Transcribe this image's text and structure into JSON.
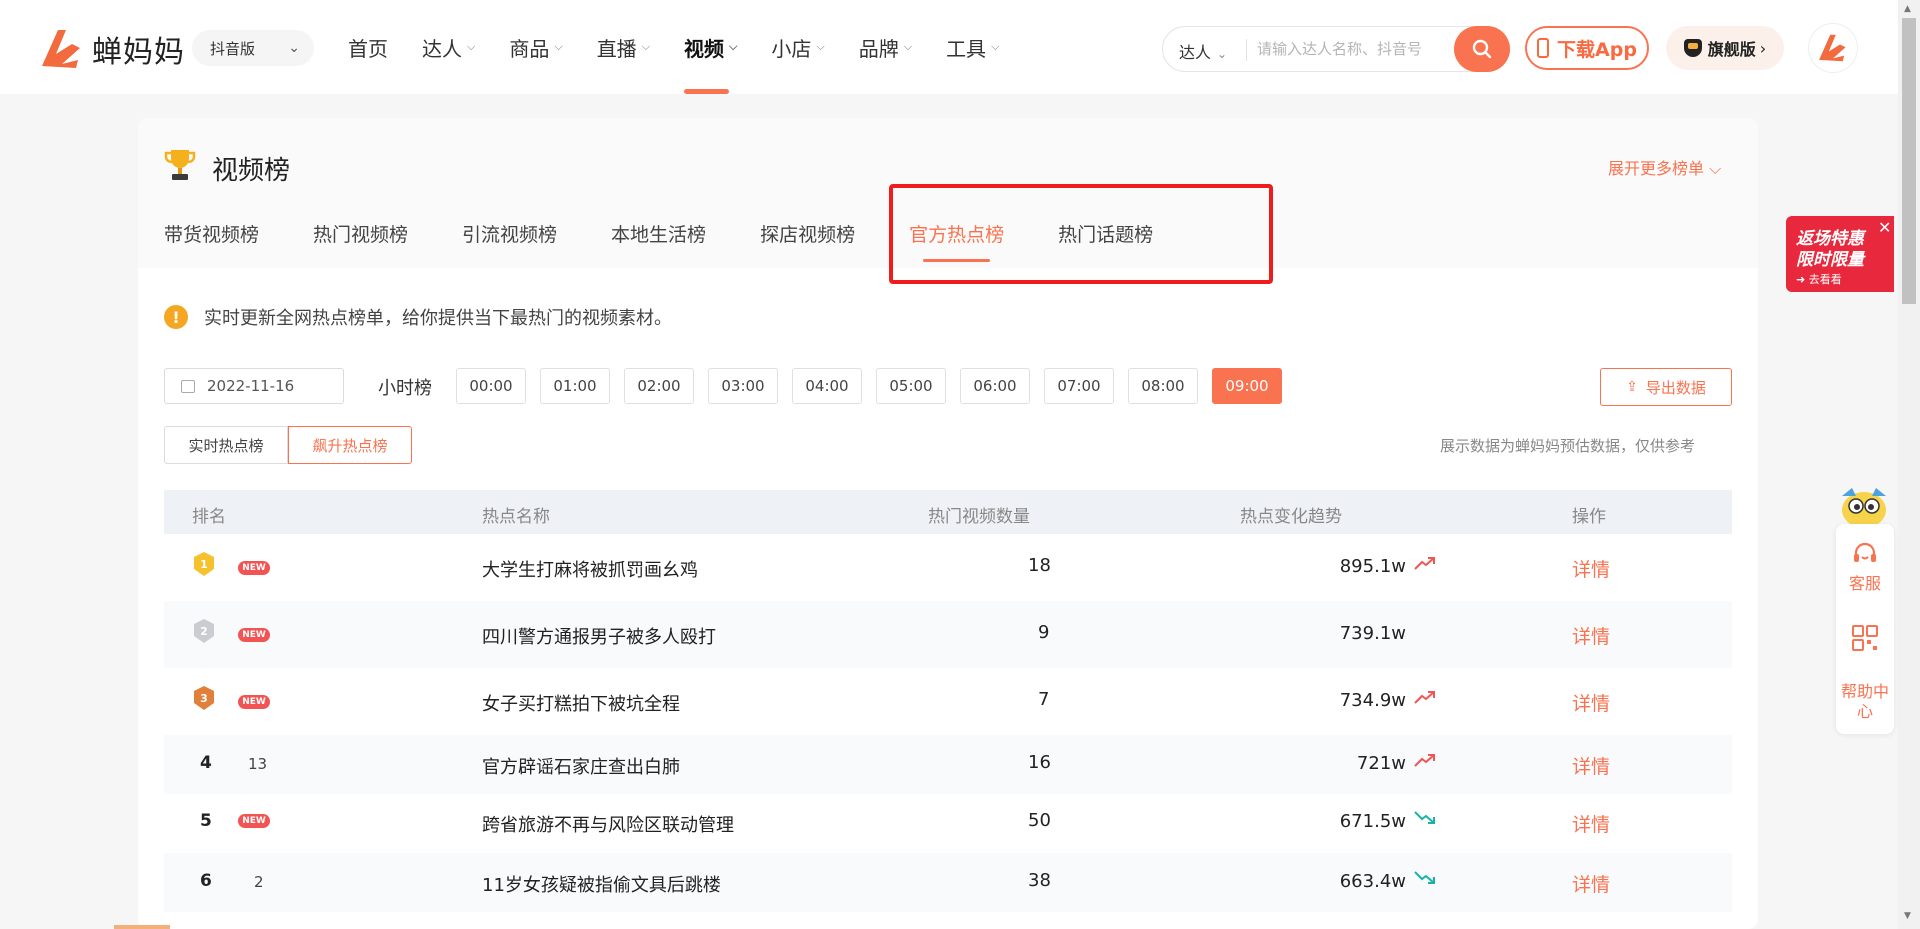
{
  "header": {
    "logo_text": "蝉妈妈",
    "platform": "抖音版",
    "nav": [
      {
        "label": "首页",
        "dropdown": false,
        "active": false
      },
      {
        "label": "达人",
        "dropdown": true,
        "active": false
      },
      {
        "label": "商品",
        "dropdown": true,
        "active": false
      },
      {
        "label": "直播",
        "dropdown": true,
        "active": false
      },
      {
        "label": "视频",
        "dropdown": true,
        "active": true
      },
      {
        "label": "小店",
        "dropdown": true,
        "active": false
      },
      {
        "label": "品牌",
        "dropdown": true,
        "active": false
      },
      {
        "label": "工具",
        "dropdown": true,
        "active": false
      }
    ],
    "search": {
      "type": "达人",
      "placeholder": "请输入达人名称、抖音号"
    },
    "download_label": "下载App",
    "flagship_label": "旗舰版"
  },
  "page": {
    "title": "视频榜",
    "expand_more": "展开更多榜单",
    "tabs": [
      {
        "label": "带货视频榜",
        "active": false
      },
      {
        "label": "热门视频榜",
        "active": false
      },
      {
        "label": "引流视频榜",
        "active": false
      },
      {
        "label": "本地生活榜",
        "active": false
      },
      {
        "label": "探店视频榜",
        "active": false
      },
      {
        "label": "官方热点榜",
        "active": true
      },
      {
        "label": "热门话题榜",
        "active": false
      }
    ],
    "notice": "实时更新全网热点榜单，给你提供当下最热门的视频素材。",
    "date": "2022-11-16",
    "hour_label": "小时榜",
    "hours": [
      "00:00",
      "01:00",
      "02:00",
      "03:00",
      "04:00",
      "05:00",
      "06:00",
      "07:00",
      "08:00",
      "09:00"
    ],
    "active_hour": "09:00",
    "export_label": "导出数据",
    "subtabs": [
      {
        "label": "实时热点榜",
        "active": false
      },
      {
        "label": "飙升热点榜",
        "active": true
      }
    ],
    "disclaimer": "展示数据为蝉妈妈预估数据，仅供参考"
  },
  "table": {
    "columns": {
      "rank": "排名",
      "name": "热点名称",
      "video_count": "热门视频数量",
      "trend": "热点变化趋势",
      "action": "操作"
    },
    "rows": [
      {
        "rank": "1",
        "medal": "gold",
        "change": "NEW",
        "name": "大学生打麻将被抓罚画幺鸡",
        "video_count": "18",
        "heat": "895.1w",
        "trend": "up",
        "action": "详情"
      },
      {
        "rank": "2",
        "medal": "silver",
        "change": "NEW",
        "name": "四川警方通报男子被多人殴打",
        "video_count": "9",
        "heat": "739.1w",
        "trend": "none",
        "action": "详情"
      },
      {
        "rank": "3",
        "medal": "bronze",
        "change": "NEW",
        "name": "女子买打糕拍下被坑全程",
        "video_count": "7",
        "heat": "734.9w",
        "trend": "up",
        "action": "详情"
      },
      {
        "rank": "4",
        "medal": "",
        "change": "13",
        "name": "官方辟谣石家庄查出白肺",
        "video_count": "16",
        "heat": "721w",
        "trend": "up",
        "action": "详情"
      },
      {
        "rank": "5",
        "medal": "",
        "change": "NEW",
        "name": "跨省旅游不再与风险区联动管理",
        "video_count": "50",
        "heat": "671.5w",
        "trend": "down",
        "action": "详情"
      },
      {
        "rank": "6",
        "medal": "",
        "change": "2",
        "name": "11岁女孩疑被指偷文具后跳楼",
        "video_count": "38",
        "heat": "663.4w",
        "trend": "down",
        "action": "详情"
      }
    ]
  },
  "promo": {
    "line1": "返场特惠",
    "line2": "限时限量",
    "line3": "去看看"
  },
  "side_panel": {
    "service": "客服",
    "help": "帮助中心"
  },
  "colors": {
    "accent": "#fa7350",
    "up": "#f25353",
    "down": "#19b3a6",
    "highlight": "#ee1c1c"
  }
}
